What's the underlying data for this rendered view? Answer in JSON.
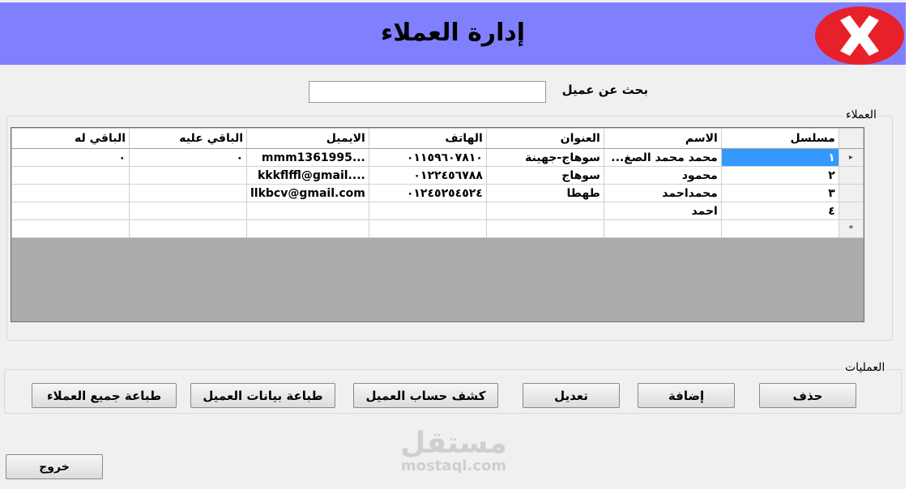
{
  "header": {
    "title": "إدارة العملاء",
    "close_icon": "close-x-icon",
    "background_color": "#8080ff",
    "close_color": "#e8202a"
  },
  "search": {
    "label": "بحث عن عميل",
    "value": ""
  },
  "customers_group": {
    "label": "العملاء"
  },
  "grid": {
    "columns": [
      "مسلسل",
      "الاسم",
      "العنوان",
      "الهاتف",
      "الايميل",
      "الباقي عليه",
      "الباقي له"
    ],
    "rows": [
      {
        "serial": "١",
        "name": "محمد محمد الصغ...",
        "address": "سوهاج-جهينة",
        "phone": "٠١١٥٩٦٠٧٨١٠",
        "email": "mmm1361995...",
        "owed": "٠",
        "credit": "٠"
      },
      {
        "serial": "٢",
        "name": "محمود",
        "address": "سوهاج",
        "phone": "٠١٢٢٤٥٦٧٨٨",
        "email": "kkkflffl@gmail....",
        "owed": "",
        "credit": ""
      },
      {
        "serial": "٣",
        "name": "محمداحمد",
        "address": "طهطا",
        "phone": "٠١٢٤٥٢٥٤٥٢٤",
        "email": "llkbcv@gmail.com",
        "owed": "",
        "credit": ""
      },
      {
        "serial": "٤",
        "name": "احمد",
        "address": "",
        "phone": "",
        "email": "",
        "owed": "",
        "credit": ""
      }
    ],
    "current_row_marker": "▸",
    "new_row_marker": "*",
    "selection_color": "#3399ff"
  },
  "operations_group": {
    "label": "العمليات"
  },
  "buttons": {
    "delete": "حذف",
    "add": "إضافة",
    "edit": "تعديل",
    "statement": "كشف حساب العميل",
    "print_customer": "طباعة بيانات العميل",
    "print_all": "طباعة جميع العملاء",
    "exit": "خروج"
  },
  "watermark": {
    "arabic": "مستقل",
    "latin": "mostaql.com"
  }
}
